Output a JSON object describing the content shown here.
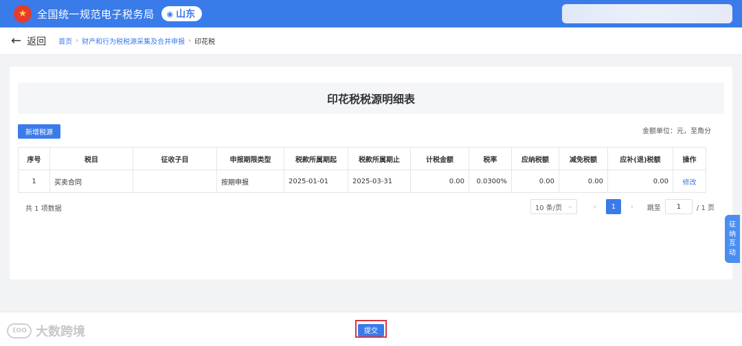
{
  "header": {
    "site_title": "全国统一规范电子税务局",
    "region": "山东",
    "colors": {
      "brand": "#3a7bea"
    }
  },
  "breadcrumb": {
    "back_label": "返回",
    "items": [
      "首页",
      "财产和行为税税源采集及合并申报",
      "印花税"
    ],
    "separator": "›"
  },
  "main": {
    "title": "印花税税源明细表",
    "add_button_label": "新增税源",
    "unit_note": "金额单位：元，至角分"
  },
  "table": {
    "headers": [
      "序号",
      "税目",
      "征收子目",
      "申报期限类型",
      "税款所属期起",
      "税款所属期止",
      "计税金额",
      "税率",
      "应纳税额",
      "减免税额",
      "应补(退)税额",
      "操作"
    ],
    "rows": [
      [
        "1",
        "买卖合同",
        "",
        "按期申报",
        "2025-01-01",
        "2025-03-31",
        "0.00",
        "0.0300%",
        "0.00",
        "0.00",
        "0.00",
        "修改"
      ]
    ]
  },
  "pagination": {
    "total_text": "共 1 项数据",
    "page_size": "10 条/页",
    "current_page": "1",
    "jump_label": "跳至",
    "jump_value": "1",
    "total_pages": "/ 1 页",
    "prev_icon": "‹",
    "next_icon": "›"
  },
  "side_tab": {
    "chars": [
      "征",
      "纳",
      "互",
      "动"
    ]
  },
  "footer": {
    "submit_label": "提交",
    "watermark": "大数跨境",
    "watermark_icon": "{OO"
  }
}
